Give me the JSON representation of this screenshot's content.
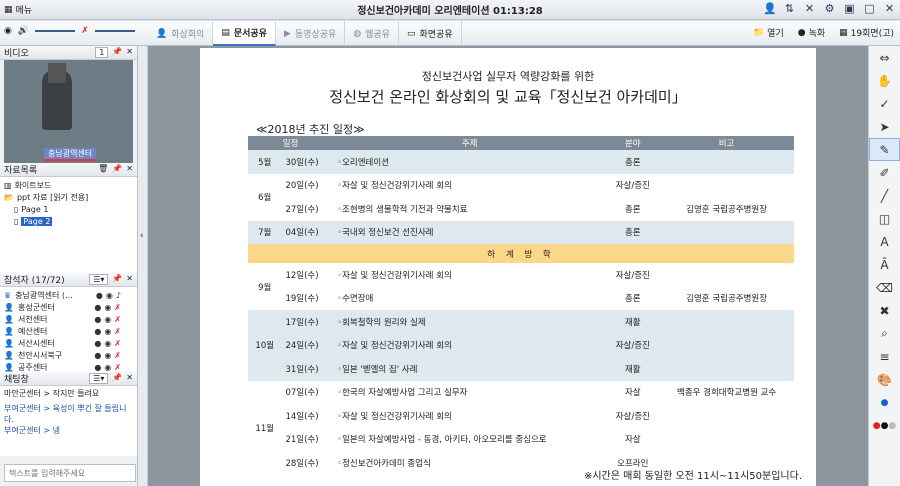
{
  "title": "정신보건아카데미 오리엔테이션 01:13:28",
  "menu": "메뉴",
  "tabs": [
    "화상회의",
    "문서공유",
    "동영상공유",
    "웹공유",
    "화면공유"
  ],
  "rtools": {
    "open": "열기",
    "record": "녹화",
    "count": "19회면(고)"
  },
  "video": {
    "title": "비디오",
    "sel": "1",
    "label": "충남광역센터"
  },
  "files": {
    "title": "자료목록",
    "items": [
      "화이트보드",
      "ppt 자료 [읽기 전용]",
      "Page 1",
      "Page 2"
    ]
  },
  "participants": {
    "title": "참석자 (17/72)",
    "items": [
      "충남광역센터 (...",
      "홍성군센터",
      "서천센터",
      "예산센터",
      "서산시센터",
      "천안시서북구",
      "공주센터"
    ]
  },
  "chat": {
    "title": "채팅창",
    "lines": [
      "마안군센터 > 작지만 들려요",
      "부여군센터 > 육성이 뿌긴 잘 들립니다.",
      "부여군센터 > 넹"
    ],
    "placeholder": "텍스트를 입력해주세요"
  },
  "doc": {
    "line1": "정신보건사업 실무자 역량강화를 위한",
    "line2": "정신보건 온라인 화상회의 및 교육「정신보건 아카데미」",
    "sched": "≪2018년 추진 일정≫",
    "headers": [
      "일정",
      "주제",
      "분야",
      "비고"
    ],
    "rows": [
      {
        "m": "5월",
        "d": "30일(수)",
        "t": "◦오리엔테이션",
        "f": "총론",
        "n": ""
      },
      {
        "m": "6월",
        "d": "20일(수)",
        "t": "◦자살 및 정신건강위기사례 회의",
        "f": "자살/증진",
        "n": ""
      },
      {
        "m": "",
        "d": "27일(수)",
        "t": "◦조현병의 생물학적 기전과 약물치료",
        "f": "총론",
        "n": "김영훈 국립공주병원장"
      },
      {
        "m": "7월",
        "d": "04일(수)",
        "t": "◦국내외 정신보건 선진사례",
        "f": "총론",
        "n": ""
      },
      {
        "m": "9월",
        "d": "12일(수)",
        "t": "◦자살 및 정신건강위기사례 회의",
        "f": "자살/증진",
        "n": ""
      },
      {
        "m": "",
        "d": "19일(수)",
        "t": "◦수면장애",
        "f": "총론",
        "n": "김영훈 국립공주병원장"
      },
      {
        "m": "10월",
        "d": "17일(수)",
        "t": "◦회복철학의 원리와 실제",
        "f": "재활",
        "n": ""
      },
      {
        "m": "",
        "d": "24일(수)",
        "t": "◦자살 및 정신건강위기사례 회의",
        "f": "자살/증진",
        "n": ""
      },
      {
        "m": "",
        "d": "31일(수)",
        "t": "◦일본 '벧엘의 집' 사례",
        "f": "재활",
        "n": ""
      },
      {
        "m": "11월",
        "d": "07일(수)",
        "t": "◦한국의 자살예방사업 그리고 실무자",
        "f": "자살",
        "n": "백종우 경희대학교병원 교수"
      },
      {
        "m": "",
        "d": "14일(수)",
        "t": "◦자살 및 정신건강위기사례 회의",
        "f": "자살/증진",
        "n": ""
      },
      {
        "m": "",
        "d": "21일(수)",
        "t": "◦일본의 자살예방사업 - 동경, 아키타, 아오모리를 중심으로",
        "f": "자살",
        "n": ""
      },
      {
        "m": "",
        "d": "28일(수)",
        "t": "◦정신보건아카데미 종업식",
        "f": "오프라인",
        "n": ""
      }
    ],
    "rest": "하 계 방 학",
    "foot": "※시간은 매회 동일한 오전 11시~11시50분입니다."
  }
}
